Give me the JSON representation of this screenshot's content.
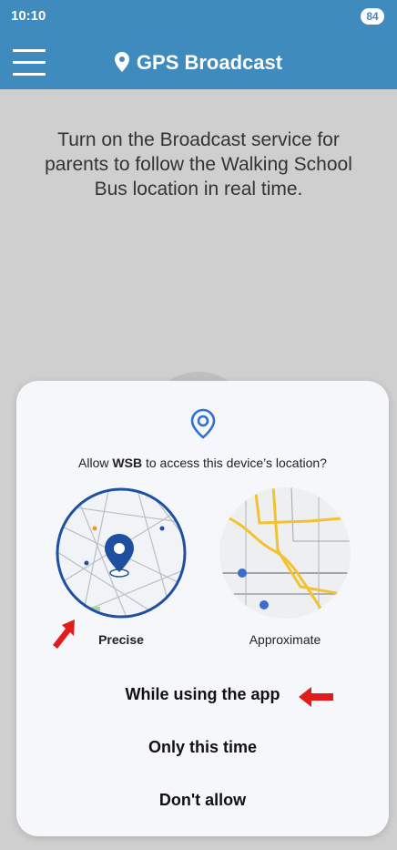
{
  "status": {
    "time": "10:10",
    "battery": "84"
  },
  "app_bar": {
    "title": "GPS Broadcast"
  },
  "intro": {
    "text": "Turn on the Broadcast service for parents to follow the Walking School Bus location in real time."
  },
  "dialog": {
    "question_prefix": "Allow ",
    "app_name": "WSB",
    "question_suffix": " to access this device’s location?",
    "precise_label": "Precise",
    "approximate_label": "Approximate",
    "while_using": "While using the app",
    "only_this_time": "Only this time",
    "dont_allow": "Don't allow"
  },
  "colors": {
    "header": "#3f8bbd",
    "accent": "#1e4fa0",
    "annotation": "#e21b1b",
    "road": "#f2c230"
  },
  "icons": [
    "menu-icon",
    "location-pin-icon",
    "location-icon",
    "red-arrow-icon"
  ]
}
